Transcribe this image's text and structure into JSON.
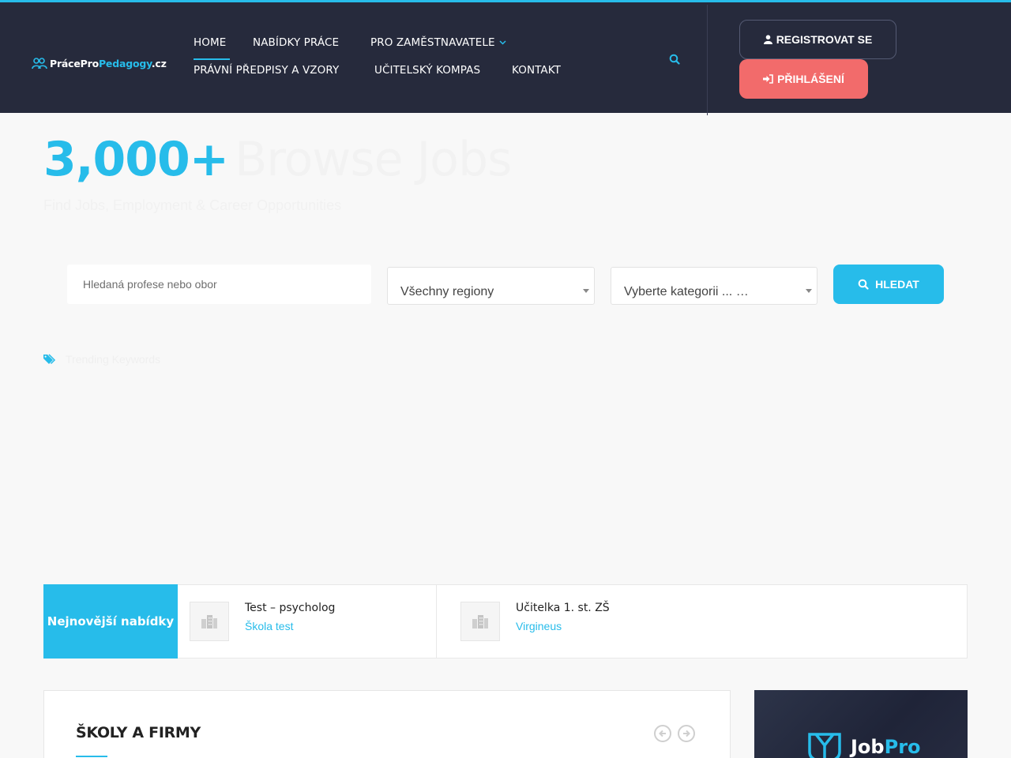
{
  "brand": {
    "logo_part1": "PrácePro",
    "logo_part2": "Pedagogy",
    "logo_part3": ".cz",
    "accent_color": "#27bcea",
    "header_bg": "#262a3c"
  },
  "nav": {
    "items": [
      {
        "label": "HOME",
        "active": true
      },
      {
        "label": "NABÍDKY PRÁCE"
      },
      {
        "label": "PRO ZAMĚSTNAVATELE",
        "dropdown": true
      },
      {
        "label": "PRÁVNÍ PŘEDPISY A VZORY"
      },
      {
        "label": "UČITELSKÝ KOMPAS"
      },
      {
        "label": "KONTAKT"
      }
    ]
  },
  "auth": {
    "register_label": "REGISTROVAT SE",
    "register_icon": "user-icon",
    "login_label": "PŘIHLÁŠENÍ",
    "login_icon": "sign-in-icon",
    "login_color": "#f26b6b"
  },
  "hero": {
    "count": "3,000+",
    "headline": "Browse Jobs",
    "subline": "Find Jobs, Employment & Career Opportunities"
  },
  "search": {
    "keyword_placeholder": "Hledaná profese nebo obor",
    "region_value": "Všechny regiony",
    "category_value": "Vyberte kategorii ... …",
    "button_label": "HLEDAT",
    "button_icon": "search-icon"
  },
  "tags": {
    "icon": "tags-icon",
    "text": "Trending Keywords"
  },
  "latest": {
    "label": "Nejnovější nabídky",
    "jobs": [
      {
        "title": "Test – psycholog",
        "company": "Škola test"
      },
      {
        "title": "Učitelka 1. st. ZŠ",
        "company": "Virgineus"
      }
    ]
  },
  "schools": {
    "title": "ŠKOLY A FIRMY",
    "prev_icon": "arrow-left-icon",
    "next_icon": "arrow-right-icon"
  },
  "ad": {
    "brand_part1": "Job",
    "brand_part2": "Pro"
  }
}
